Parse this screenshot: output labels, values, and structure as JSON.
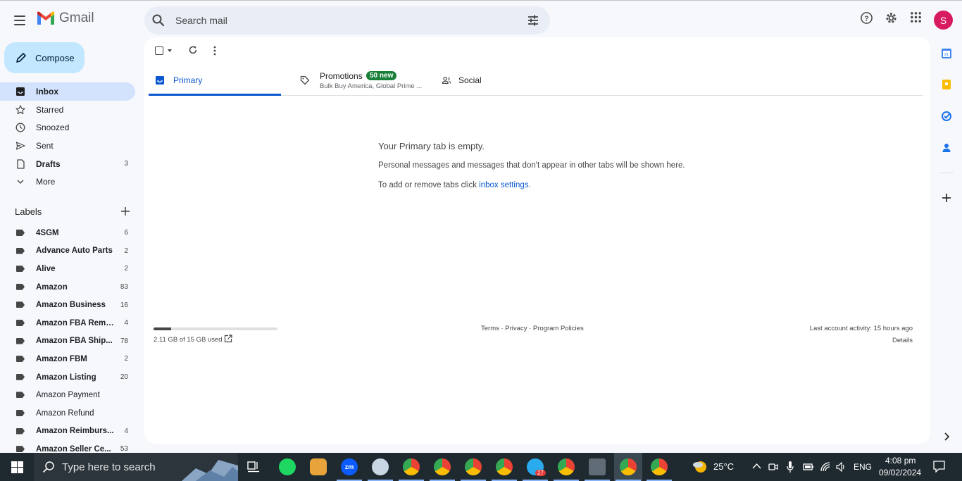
{
  "app": {
    "name": "Gmail"
  },
  "search": {
    "placeholder": "Search mail"
  },
  "compose_label": "Compose",
  "nav": [
    {
      "label": "Inbox",
      "count": "",
      "bold": true,
      "active": true,
      "icon": "inbox-icon"
    },
    {
      "label": "Starred",
      "count": "",
      "bold": false,
      "active": false,
      "icon": "star-icon"
    },
    {
      "label": "Snoozed",
      "count": "",
      "bold": false,
      "active": false,
      "icon": "clock-icon"
    },
    {
      "label": "Sent",
      "count": "",
      "bold": false,
      "active": false,
      "icon": "send-icon"
    },
    {
      "label": "Drafts",
      "count": "3",
      "bold": true,
      "active": false,
      "icon": "draft-icon"
    },
    {
      "label": "More",
      "count": "",
      "bold": false,
      "active": false,
      "icon": "chevron-down-icon"
    }
  ],
  "labels_heading": "Labels",
  "labels": [
    {
      "label": "4SGM",
      "count": "6",
      "bold": true
    },
    {
      "label": "Advance Auto Parts",
      "count": "2",
      "bold": true
    },
    {
      "label": "Alive",
      "count": "2",
      "bold": true
    },
    {
      "label": "Amazon",
      "count": "83",
      "bold": true
    },
    {
      "label": "Amazon Business",
      "count": "16",
      "bold": true
    },
    {
      "label": "Amazon FBA Remo...",
      "count": "4",
      "bold": true
    },
    {
      "label": "Amazon FBA Ship...",
      "count": "78",
      "bold": true
    },
    {
      "label": "Amazon FBM",
      "count": "2",
      "bold": true
    },
    {
      "label": "Amazon Listing",
      "count": "20",
      "bold": true
    },
    {
      "label": "Amazon Payment",
      "count": "",
      "bold": false
    },
    {
      "label": "Amazon Refund",
      "count": "",
      "bold": false
    },
    {
      "label": "Amazon Reimburs...",
      "count": "4",
      "bold": true
    },
    {
      "label": "Amazon Seller Ce...",
      "count": "53",
      "bold": true
    }
  ],
  "tabs": {
    "primary": "Primary",
    "promotions": "Promotions",
    "promotions_badge": "50 new",
    "promotions_sub": "Bulk Buy America, Global Prime ...",
    "social": "Social"
  },
  "empty_state": {
    "title": "Your Primary tab is empty.",
    "line1": "Personal messages and messages that don't appear in other tabs will be shown here.",
    "line2_prefix": "To add or remove tabs click ",
    "line2_link": "inbox settings",
    "line2_suffix": "."
  },
  "storage": {
    "text": "2.11 GB of 15 GB used",
    "used_fraction": 0.14
  },
  "footer_links": "Terms · Privacy · Program Policies",
  "activity": {
    "text": "Last account activity: 15 hours ago",
    "details": "Details"
  },
  "account_initial": "S",
  "taskbar": {
    "search_placeholder": "Type here to search",
    "weather": "25°C",
    "language": "ENG",
    "time": "4:08 pm",
    "date": "09/02/2024",
    "telegram_badge": "27"
  },
  "colors": {
    "accent": "#0b57d0",
    "compose_bg": "#c2e7ff",
    "active_nav": "#d3e3fd",
    "badge_green": "#188038",
    "avatar": "#d81b60"
  }
}
